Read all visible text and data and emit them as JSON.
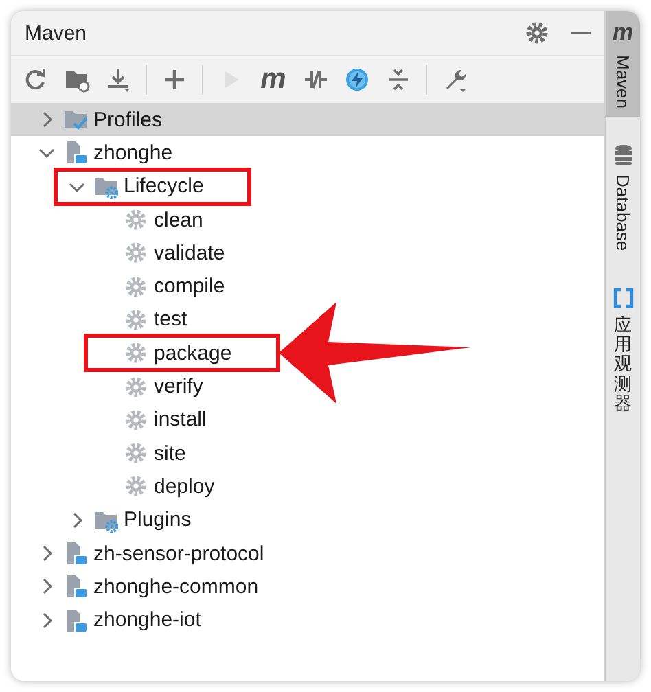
{
  "panel": {
    "title": "Maven"
  },
  "toolbar": [
    {
      "kind": "refresh",
      "disabled": false
    },
    {
      "kind": "add-folder",
      "disabled": false
    },
    {
      "kind": "download",
      "disabled": false
    },
    {
      "kind": "separator"
    },
    {
      "kind": "plus",
      "disabled": false
    },
    {
      "kind": "separator"
    },
    {
      "kind": "run",
      "disabled": true
    },
    {
      "kind": "text",
      "label": "m",
      "disabled": false
    },
    {
      "kind": "skip-tests",
      "disabled": false
    },
    {
      "kind": "offline",
      "disabled": false
    },
    {
      "kind": "collapse",
      "disabled": false
    },
    {
      "kind": "separator"
    },
    {
      "kind": "wrench",
      "disabled": false
    }
  ],
  "tree": [
    {
      "kind": "profiles",
      "label": "Profiles",
      "expanded": false,
      "selected": true
    },
    {
      "kind": "module",
      "label": "zhonghe",
      "expanded": true,
      "selected": false,
      "children": [
        {
          "kind": "folder",
          "label": "Lifecycle",
          "expanded": true,
          "selected": false,
          "annotated": true,
          "children": [
            {
              "kind": "goal",
              "label": "clean",
              "selected": false
            },
            {
              "kind": "goal",
              "label": "validate",
              "selected": false
            },
            {
              "kind": "goal",
              "label": "compile",
              "selected": false
            },
            {
              "kind": "goal",
              "label": "test",
              "selected": false
            },
            {
              "kind": "goal",
              "label": "package",
              "selected": false,
              "annotated": true,
              "arrow": true
            },
            {
              "kind": "goal",
              "label": "verify",
              "selected": false
            },
            {
              "kind": "goal",
              "label": "install",
              "selected": false
            },
            {
              "kind": "goal",
              "label": "site",
              "selected": false
            },
            {
              "kind": "goal",
              "label": "deploy",
              "selected": false
            }
          ]
        },
        {
          "kind": "folder",
          "label": "Plugins",
          "expanded": false,
          "selected": false
        }
      ]
    },
    {
      "kind": "module",
      "label": "zh-sensor-protocol",
      "expanded": false,
      "selected": false
    },
    {
      "kind": "module",
      "label": "zhonghe-common",
      "expanded": false,
      "selected": false
    },
    {
      "kind": "module",
      "label": "zhonghe-iot",
      "expanded": false,
      "selected": false
    }
  ],
  "side_tabs": [
    {
      "kind": "maven",
      "glyph": "m",
      "label": "Maven",
      "selected": true
    },
    {
      "kind": "database",
      "label": "Database",
      "selected": false
    },
    {
      "kind": "observer",
      "label": "应用观测器",
      "selected": false
    }
  ]
}
